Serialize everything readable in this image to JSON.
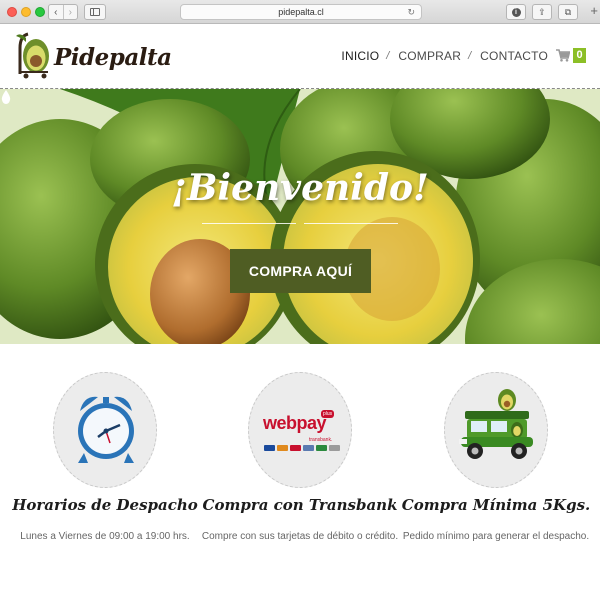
{
  "browser": {
    "url": "pidepalta.cl",
    "back_glyph": "‹",
    "forward_glyph": "›",
    "reload_glyph": "↻",
    "info_glyph": "i",
    "share_glyph": "⇪",
    "tabs_glyph": "⧉",
    "newtab_glyph": "+"
  },
  "site": {
    "logo_text": "Pidepalta",
    "nav": [
      {
        "label": "INICIO",
        "sep": "/"
      },
      {
        "label": "COMPRAR",
        "sep": "/"
      },
      {
        "label": "CONTACTO"
      }
    ],
    "cart_count": "0",
    "accent_color": "#8cbf26"
  },
  "hero": {
    "title": "¡Bienvenido!",
    "cta_label": "COMPRA AQUÍ",
    "cta_color": "#4f5d23"
  },
  "features": [
    {
      "title": "Horarios de Despacho",
      "desc": "Lunes a Viernes de 09:00 a 19:00 hrs.",
      "icon": "alarm-clock-icon"
    },
    {
      "title": "Compra con Transbank",
      "desc": "Compre con sus tarjetas de débito o crédito.",
      "icon": "webpay-logo",
      "logo": {
        "word": "webpay",
        "plus": "plus",
        "brand": "transbank."
      }
    },
    {
      "title": "Compra Mínima 5Kgs.",
      "desc": "Pedido mínimo para generar el despacho.",
      "icon": "delivery-truck-icon"
    }
  ]
}
